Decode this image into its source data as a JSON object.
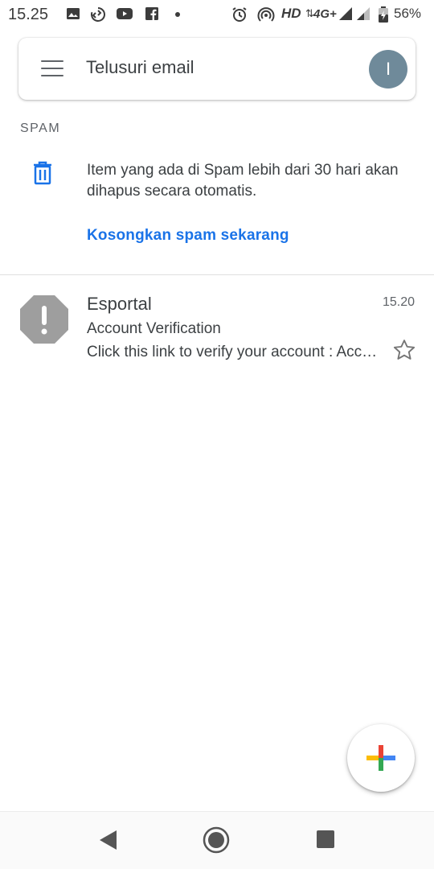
{
  "status_bar": {
    "time": "15.25",
    "network": "HD",
    "network_type": "4G+",
    "battery": "56%",
    "icons": [
      "image-icon",
      "sync-icon",
      "youtube-icon",
      "facebook-icon",
      "dot-icon",
      "alarm-icon",
      "hotspot-icon",
      "signal-icon",
      "battery-icon"
    ]
  },
  "search": {
    "placeholder": "Telusuri email",
    "avatar_letter": "I",
    "avatar_color": "#6f8a9a"
  },
  "folder": {
    "label": "SPAM",
    "info": "Item yang ada di Spam lebih dari 30 hari akan dihapus secara otomatis.",
    "empty_action": "Kosongkan spam sekarang"
  },
  "emails": [
    {
      "sender": "Esportal",
      "time": "15.20",
      "subject": "Account Verification",
      "snippet": "Click this link to verify your account : Account verification link"
    }
  ],
  "colors": {
    "accent": "#1a73e8",
    "warning_icon": "#9e9e9e"
  }
}
